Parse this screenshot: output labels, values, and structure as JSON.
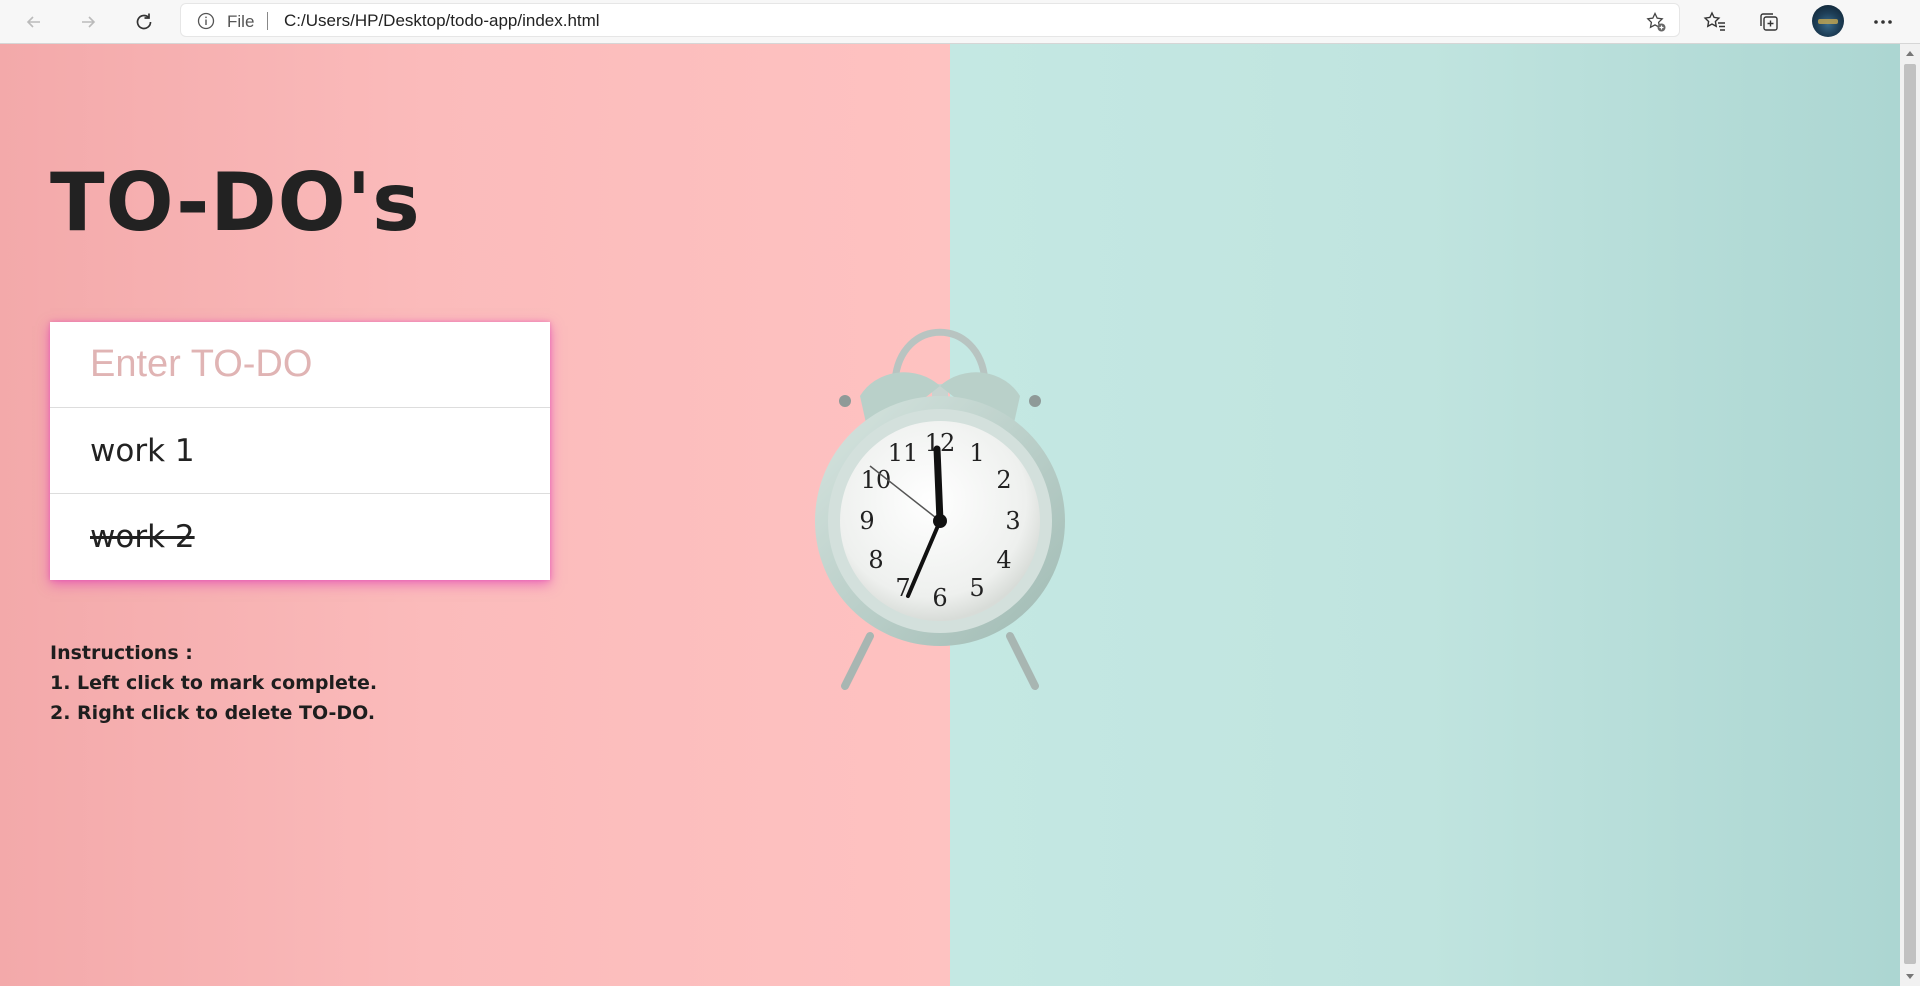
{
  "browser": {
    "address_prefix": "File",
    "url": "C:/Users/HP/Desktop/todo-app/index.html",
    "icons": {
      "back": "arrow-left-icon",
      "forward": "arrow-right-icon",
      "refresh": "refresh-icon",
      "info": "info-icon",
      "add_favorite": "star-plus-icon",
      "favorites": "favorites-icon",
      "collections": "collections-icon",
      "menu": "more-icon"
    }
  },
  "page": {
    "title": "TO-DO's",
    "input_placeholder": "Enter TO-DO",
    "todos": [
      {
        "text": "work 1",
        "completed": false
      },
      {
        "text": "work 2",
        "completed": true
      }
    ],
    "instructions": {
      "heading": "Instructions :",
      "lines": [
        "1. Left click to mark complete.",
        "2. Right click to delete TO-DO."
      ]
    },
    "colors": {
      "left_background": "#fbbbbb",
      "right_background": "#c0e4df",
      "card_glow": "#dc28b4",
      "placeholder": "#e0b4b4"
    }
  }
}
